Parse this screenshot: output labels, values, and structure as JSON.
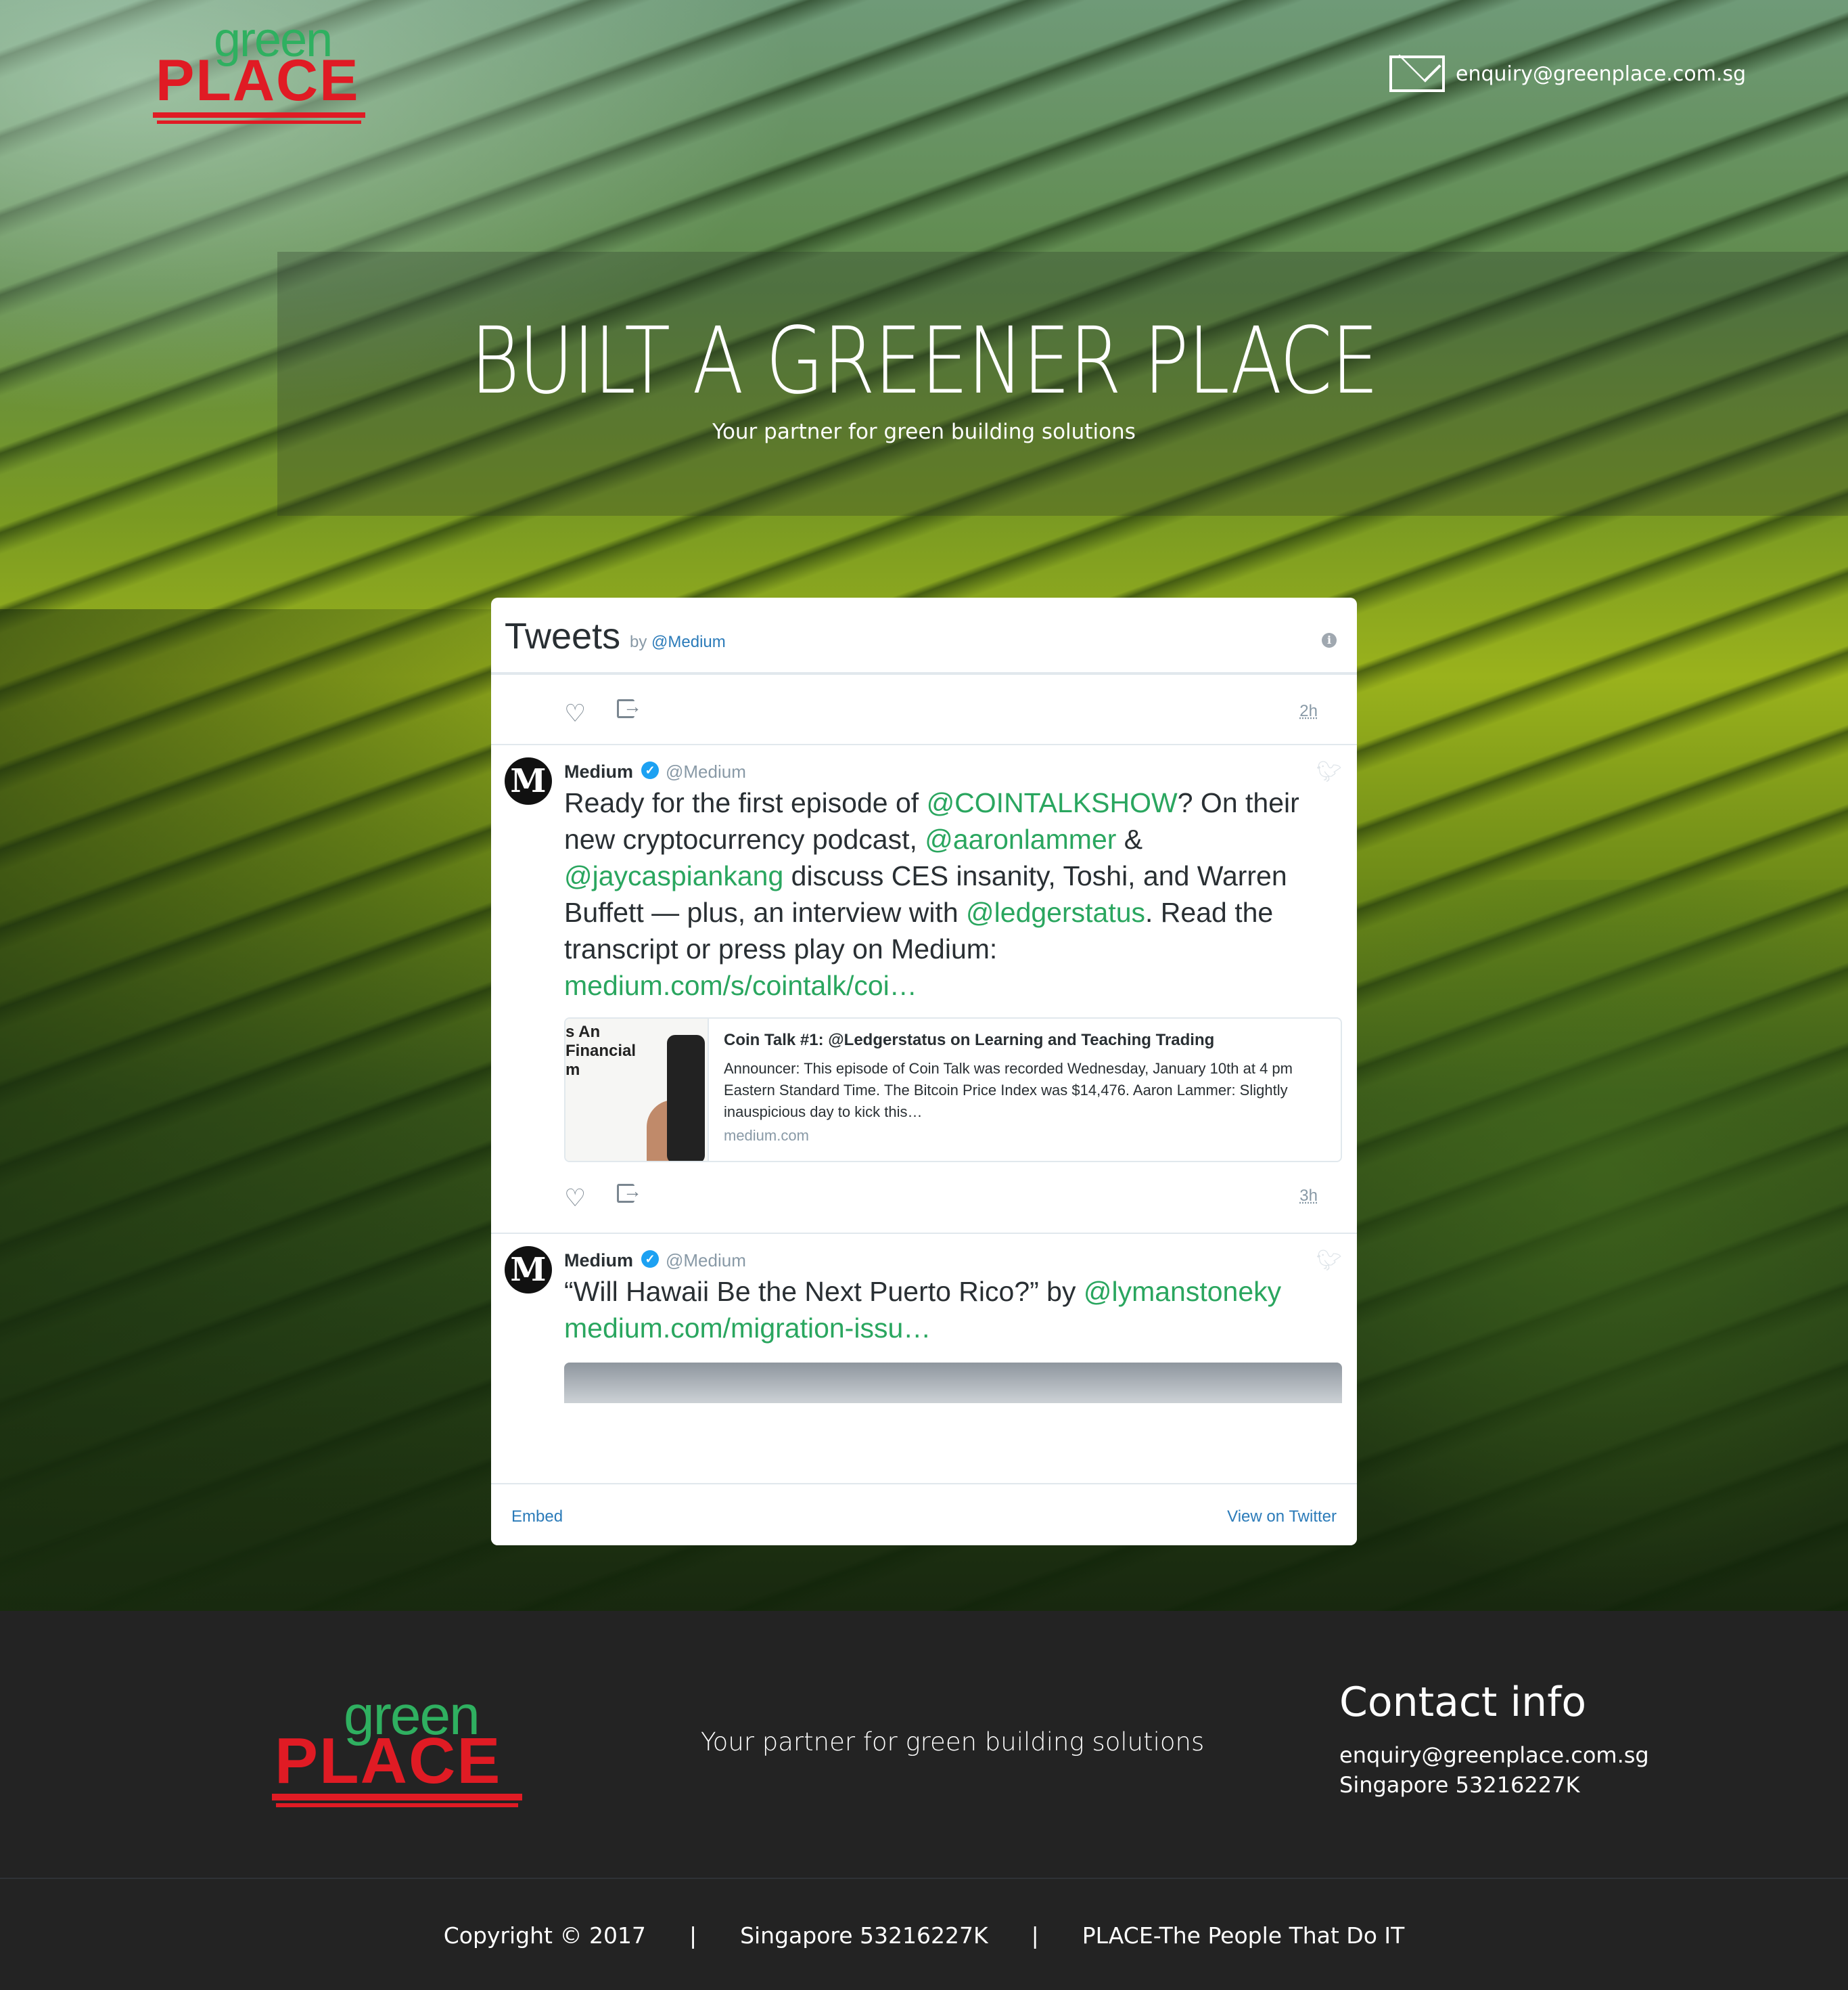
{
  "header": {
    "logo": {
      "green": "green",
      "place": "PLACE"
    },
    "email": "enquiry@greenplace.com.sg"
  },
  "hero": {
    "title": "BUILT A GREENER PLACE",
    "subtitle": "Your partner for green building solutions"
  },
  "widget": {
    "title": "Tweets",
    "by": "by",
    "by_handle": "@Medium",
    "info": "i",
    "top_time": "2h",
    "tweets": [
      {
        "avatar": "M",
        "name": "Medium",
        "verified": "✓",
        "handle": "@Medium",
        "text": [
          "Ready for the first episode of ",
          "@COINTALKSHOW",
          "? On their new cryptocurrency podcast, ",
          "@aaronlammer",
          " & ",
          "@jaycaspiankang",
          " discuss CES insanity, Toshi, and Warren Buffett — plus, an interview with ",
          "@ledgerstatus",
          ". Read the transcript or press play on Medium: ",
          "medium.com/s/cointalk/coi…"
        ],
        "card": {
          "image_text": "s An\nFinancial\nm",
          "title": "Coin Talk #1: @Ledgerstatus on Learning and Teaching Trading",
          "description": "Announcer: This episode of Coin Talk was recorded Wednesday, January 10th at 4 pm Eastern Standard Time. The Bitcoin Price Index was $14,476. Aaron Lammer: Slightly inauspicious day to kick this…",
          "domain": "medium.com"
        },
        "time": "3h"
      },
      {
        "avatar": "M",
        "name": "Medium",
        "verified": "✓",
        "handle": "@Medium",
        "text": [
          "“Will Hawaii Be the Next Puerto Rico?” by ",
          "@lymanstoneky",
          " ",
          "medium.com/migration-issu…"
        ]
      }
    ],
    "footer": {
      "embed": "Embed",
      "view": "View on Twitter"
    }
  },
  "footer": {
    "logo": {
      "green": "green",
      "place": "PLACE"
    },
    "tagline": "Your partner for green building solutions",
    "contact_title": "Contact info",
    "contact_email": "enquiry@greenplace.com.sg",
    "contact_address": "Singapore 53216227K",
    "bottom": {
      "copyright": "Copyright © 2017",
      "sep1": "|",
      "address": "Singapore 53216227K",
      "sep2": "|",
      "slogan": "PLACE-The People That Do IT"
    }
  },
  "colors": {
    "brand_green": "#2fb060",
    "brand_red": "#e01b24",
    "link_green": "#2aa65f",
    "twitter_blue": "#2b7bb9",
    "footer_bg": "#232323"
  },
  "icons": [
    "mail-icon",
    "info-icon",
    "heart-icon",
    "share-icon",
    "verified-icon",
    "twitter-bird-icon"
  ]
}
